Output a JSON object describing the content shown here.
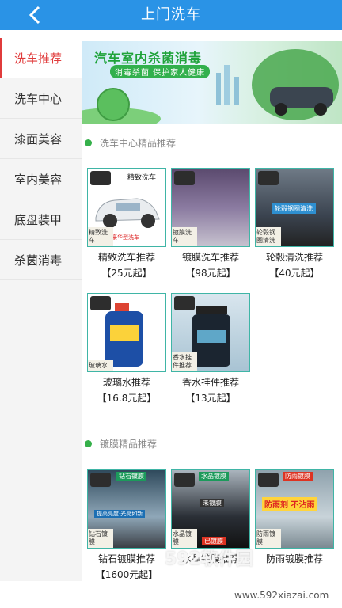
{
  "header": {
    "title": "上门洗车"
  },
  "sidebar": {
    "items": [
      {
        "label": "洗车推荐"
      },
      {
        "label": "洗车中心"
      },
      {
        "label": "漆面美容"
      },
      {
        "label": "室内美容"
      },
      {
        "label": "底盘装甲"
      },
      {
        "label": "杀菌消毒"
      }
    ]
  },
  "banner": {
    "title": "汽车室内杀菌消毒",
    "subtitle": "消毒杀菌  保护家人健康"
  },
  "sections": [
    {
      "title": "洗车中心精品推荐",
      "items": [
        {
          "name": "精致洗车推荐",
          "price": "【25元起】",
          "tag": "精致洗车",
          "top_label": "精致洗车",
          "bottom_label": "豪华型洗车"
        },
        {
          "name": "镀膜洗车推荐",
          "price": "【98元起】",
          "tag": "镀膜洗车"
        },
        {
          "name": "轮毂清洗推荐",
          "price": "【40元起】",
          "tag": "轮毂钢圈清洗",
          "overlay_label": "轮毂钢圈清洗"
        },
        {
          "name": "玻璃水推荐",
          "price": "【16.8元起】",
          "tag": "玻璃水"
        },
        {
          "name": "香水挂件推荐",
          "price": "【13元起】",
          "tag": "香水挂件推荐"
        }
      ]
    },
    {
      "title": "镀膜精品推荐",
      "items": [
        {
          "name": "钻石镀膜推荐",
          "price": "【1600元起】",
          "tag": "钻石镀膜",
          "top_label": "钻石镀膜",
          "bottom_label": "提高亮度·光亮如新"
        },
        {
          "name": "水晶镀膜推荐",
          "price": "",
          "tag": "水晶镀膜",
          "top_label": "水晶镀膜",
          "mid_label": "未镀膜",
          "bottom_label": "已镀膜"
        },
        {
          "name": "防雨镀膜推荐",
          "price": "",
          "tag": "防雨镀膜",
          "top_label": "防雨镀膜",
          "overlay_label": "防雨剂 不沾雨"
        }
      ]
    }
  ],
  "watermark": {
    "text": "592软件园",
    "url": "www.592xiazai.com"
  },
  "colors": {
    "header": "#2a93e6",
    "active": "#e03b3b",
    "accent": "#35b04a"
  }
}
